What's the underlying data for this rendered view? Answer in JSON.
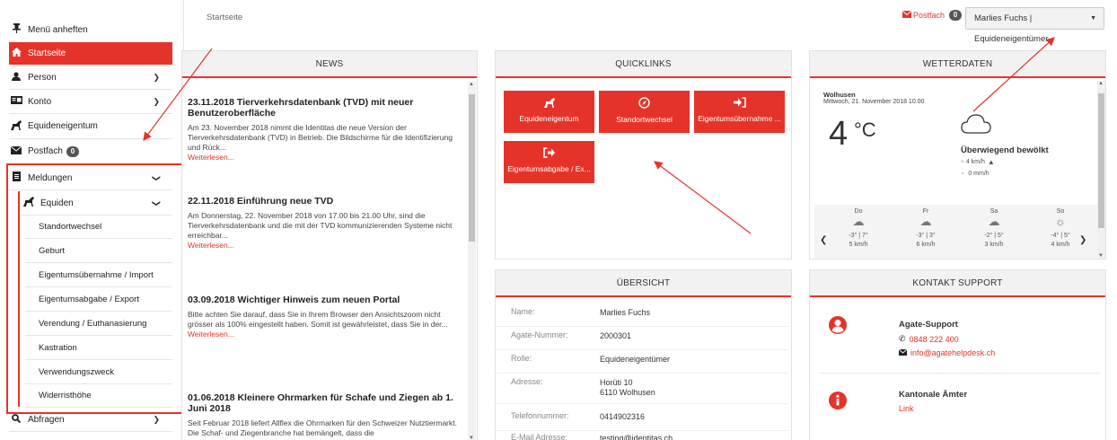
{
  "sidebar": {
    "pin_label": "Menü anheften",
    "items": [
      {
        "label": "Startseite"
      },
      {
        "label": "Person"
      },
      {
        "label": "Konto"
      },
      {
        "label": "Equideneigentum"
      },
      {
        "label": "Postfach",
        "badge": "0"
      },
      {
        "label": "Meldungen"
      },
      {
        "label": "Abfragen"
      }
    ],
    "equiden_label": "Equiden",
    "equiden_items": [
      "Standortwechsel",
      "Geburt",
      "Eigentumsübernahme / Import",
      "Eigentumsabgabe / Export",
      "Verendung / Euthanasierung",
      "Kastration",
      "Verwendungszweck",
      "Widerristhöhe"
    ]
  },
  "breadcrumb": "Startseite",
  "topbar": {
    "postfach_label": "Postfach",
    "postfach_badge": "0",
    "user_label": "Marlies Fuchs | Equideneigentümer"
  },
  "news": {
    "title": "NEWS",
    "items": [
      {
        "title": "23.11.2018 Tierverkehrsdatenbank (TVD) mit neuer Benutzeroberfläche",
        "text": "Am 23. November 2018 nimmt die Identitas die neue Version der Tierverkehrsdatenbank (TVD) in Betrieb. Die Bildschirme für die Identifizierung und Rück...",
        "more": "Weiterlesen..."
      },
      {
        "title": "22.11.2018 Einführung neue TVD",
        "text": "Am Donnerstag, 22. November 2018 von 17.00 bis 21.00 Uhr, sind die Tierverkehrsdatenbank und die mit der TVD kommunizierenden Systeme nicht erreichbar...",
        "more": "Weiterlesen..."
      },
      {
        "title": "03.09.2018 Wichtiger Hinweis zum neuen Portal",
        "text": "Bitte achten Sie darauf, dass Sie in Ihrem Browser den Ansichtszoom nicht grösser als 100% eingestellt haben. Somit ist gewährleistet, dass Sie in der...",
        "more": "Weiterlesen..."
      },
      {
        "title": "01.06.2018 Kleinere Ohrmarken für Schafe und Ziegen ab 1. Juni 2018",
        "text": "Seit Februar 2018 liefert Allflex die Ohrmarken für den Schweizer Nutztiermarkt. Die Schaf- und Ziegenbranche hat bemängelt, dass die",
        "more": ""
      }
    ]
  },
  "quicklinks": {
    "title": "QUICKLINKS",
    "items": [
      {
        "label": "Equideneigentum",
        "icon": "horse-icon"
      },
      {
        "label": "Standortwechsel",
        "icon": "compass-icon"
      },
      {
        "label": "Eigentumsübernahme ...",
        "icon": "sign-in-icon"
      },
      {
        "label": "Eigentumsabgabe / Ex...",
        "icon": "sign-out-icon"
      }
    ]
  },
  "weather": {
    "title": "WETTERDATEN",
    "location": "Wolhusen",
    "datetime": "Mittwoch, 21. November 2018 10.00",
    "temp": "4",
    "unit": "°C",
    "condition": "Überwiegend bewölkt",
    "wind": "4 km/h",
    "rain": "0 mm/h",
    "forecast": [
      {
        "day": "Do",
        "temp": "-3° | 7°",
        "wind": "5 km/h"
      },
      {
        "day": "Fr",
        "temp": "-3° | 3°",
        "wind": "6 km/h"
      },
      {
        "day": "Sa",
        "temp": "-2° | 5°",
        "wind": "3 km/h"
      },
      {
        "day": "So",
        "temp": "-4° | 5°",
        "wind": "4 km/h"
      }
    ]
  },
  "overview": {
    "title": "ÜBERSICHT",
    "rows": [
      {
        "label": "Name:",
        "value": "Marlies Fuchs"
      },
      {
        "label": "Agate-Nummer:",
        "value": "2000301"
      },
      {
        "label": "Rolle:",
        "value": "Equideneigentümer"
      },
      {
        "label": "Adresse:",
        "value": "Horüti 10",
        "value2": "6110 Wolhusen"
      },
      {
        "label": "Telefonnummer:",
        "value": "0414902316"
      },
      {
        "label": "E-Mail Adresse:",
        "value": "testing@identitas.ch"
      }
    ]
  },
  "support": {
    "title": "KONTAKT SUPPORT",
    "agate_title": "Agate-Support",
    "phone": "0848 222 400",
    "email": "info@agatehelpdesk.ch",
    "cantonal_title": "Kantonale Ämter",
    "cantonal_link": "Link"
  },
  "colors": {
    "accent": "#e63329"
  }
}
